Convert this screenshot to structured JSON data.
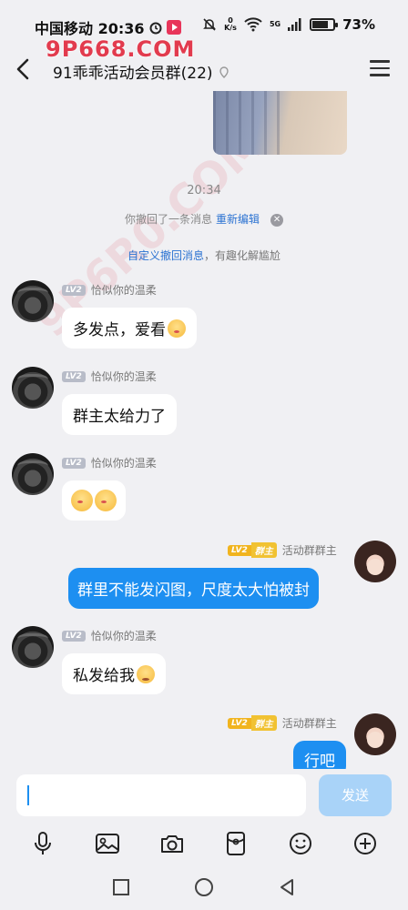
{
  "status_bar": {
    "carrier_time": "中国移动 20:36",
    "net_speed_value": "0",
    "net_speed_unit": "K/s",
    "network_type": "5G",
    "battery": "73%"
  },
  "watermark": "9P668.COM",
  "diagonal_watermark": "9P6R0.COM",
  "header": {
    "title": "91乖乖活动会员群(22)"
  },
  "chat": {
    "timestamp": "20:34",
    "recall_notice": "你撤回了一条消息",
    "recall_edit": "重新编辑",
    "custom_link": "自定义撤回消息",
    "custom_suffix": "，有趣化解尴尬",
    "messages": [
      {
        "side": "left",
        "level": "LV2",
        "sender": "恰似你的温柔",
        "text": "多发点，爱看",
        "emoji": "kiss-emoji"
      },
      {
        "side": "left",
        "level": "LV2",
        "sender": "恰似你的温柔",
        "text": "群主太给力了"
      },
      {
        "side": "left",
        "level": "LV2",
        "sender": "恰似你的温柔",
        "text": "",
        "emoji": "kiss-emoji x2"
      },
      {
        "side": "right",
        "level": "LV2",
        "role": "群主",
        "sender": "活动群群主",
        "text": "群里不能发闪图，尺度太大怕被封"
      },
      {
        "side": "left",
        "level": "LV2",
        "sender": "恰似你的温柔",
        "text": "私发给我",
        "emoji": "sad-emoji"
      },
      {
        "side": "right",
        "level": "LV2",
        "role": "群主",
        "sender": "活动群群主",
        "text": "行吧"
      }
    ]
  },
  "input": {
    "value": "",
    "send_label": "发送"
  },
  "toolbar": [
    "mic-icon",
    "image-icon",
    "camera-icon",
    "red-packet-icon",
    "emoji-icon",
    "plus-icon"
  ],
  "nav": [
    "recent-apps",
    "home",
    "back"
  ],
  "colors": {
    "accent_blue": "#1d8ff1",
    "send_disabled": "#a9d3f8",
    "watermark_red": "#e23b4e",
    "role_gold": "#f1c232"
  }
}
